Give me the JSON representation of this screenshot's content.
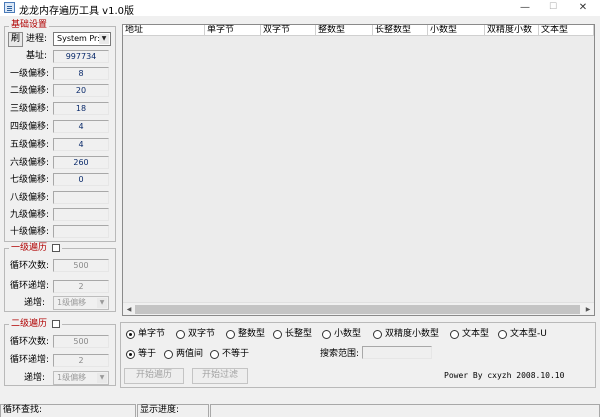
{
  "window": {
    "title": "龙龙内存遍历工具 v1.0版",
    "minimize": "—",
    "maximize": "☐",
    "close": "✕"
  },
  "basic": {
    "legend": "基础设置",
    "refresh_label": "刷",
    "process_label": "进程:",
    "process_value": "System Pr:",
    "base_label": "基址:",
    "base_value": "997734",
    "offsets": [
      {
        "label": "一级偏移:",
        "value": "8"
      },
      {
        "label": "二级偏移:",
        "value": "20"
      },
      {
        "label": "三级偏移:",
        "value": "18"
      },
      {
        "label": "四级偏移:",
        "value": "4"
      },
      {
        "label": "五级偏移:",
        "value": "4"
      },
      {
        "label": "六级偏移:",
        "value": "260"
      },
      {
        "label": "七级偏移:",
        "value": "0"
      },
      {
        "label": "八级偏移:",
        "value": ""
      },
      {
        "label": "九级偏移:",
        "value": ""
      },
      {
        "label": "十级偏移:",
        "value": ""
      }
    ]
  },
  "level1": {
    "legend": "一级遍历",
    "loop_label": "循环次数:",
    "loop_value": "500",
    "step_label": "循环递增:",
    "step_value": "2",
    "inc_label": "递增:",
    "inc_value": "1级偏移"
  },
  "level2": {
    "legend": "二级遍历",
    "loop_label": "循环次数:",
    "loop_value": "500",
    "step_label": "循环递增:",
    "step_value": "2",
    "inc_label": "递增:",
    "inc_value": "1级偏移"
  },
  "table": {
    "columns": [
      "地址",
      "单字节",
      "双字节",
      "整数型",
      "长整数型",
      "小数型",
      "双精度小数",
      "文本型"
    ]
  },
  "types": {
    "options": [
      "单字节",
      "双字节",
      "整数型",
      "长整型",
      "小数型",
      "双精度小数型",
      "文本型",
      "文本型-U"
    ],
    "selected": "单字节"
  },
  "compare": {
    "options": [
      "等于",
      "两值间",
      "不等于"
    ],
    "selected": "等于"
  },
  "search_range_label": "搜索范围:",
  "search_range_value": "",
  "buttons": {
    "start_traverse": "开始遍历",
    "start_filter": "开始过滤"
  },
  "credit": "Power By cxyzh 2008.10.10",
  "statusbar": {
    "loop_find": "循环查找:",
    "progress": "显示进度:"
  }
}
